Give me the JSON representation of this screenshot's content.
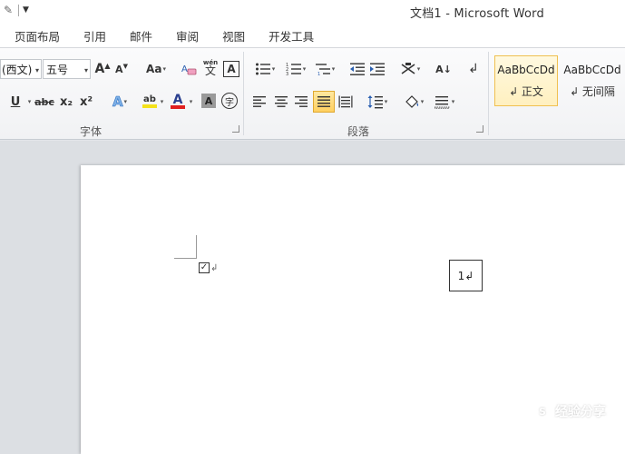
{
  "window": {
    "title": "文档1  -  Microsoft Word"
  },
  "quick_access": {
    "icons": [
      "brush-icon",
      "customize-arrow-icon"
    ]
  },
  "tabs": [
    {
      "label": "页面布局"
    },
    {
      "label": "引用"
    },
    {
      "label": "邮件"
    },
    {
      "label": "审阅"
    },
    {
      "label": "视图"
    },
    {
      "label": "开发工具"
    }
  ],
  "font_group": {
    "font_name": "(西文)",
    "font_size": "五号",
    "grow_label": "A",
    "shrink_label": "A",
    "case_label": "Aa",
    "phonetic_label": "wén",
    "phonetic_char": "文",
    "border_char_label": "A",
    "underline_label": "U",
    "strike_label": "abc",
    "subscript_label": "x₂",
    "superscript_label": "x²",
    "effects_label": "A",
    "highlight_label": "ab",
    "font_color_label": "A",
    "shading_label": "A",
    "enclose_label": "字",
    "label": "字体",
    "colors": {
      "highlight": "#f4e21a",
      "font_color": "#e02020"
    }
  },
  "paragraph_group": {
    "label": "段落",
    "sort_label": "A↓",
    "show_marks_label": "↲"
  },
  "styles_group": {
    "styles": [
      {
        "sample": "AaBbCcDd",
        "name": "↲ 正文",
        "selected": true
      },
      {
        "sample": "AaBbCcDd",
        "name": "↲ 无间隔",
        "selected": false
      }
    ]
  },
  "document": {
    "checkbox_glyph": "☑",
    "paragraph_mark": "↲",
    "textbox_text": "1↲"
  },
  "watermark": {
    "icon_text": "S",
    "text": "经验分享"
  }
}
